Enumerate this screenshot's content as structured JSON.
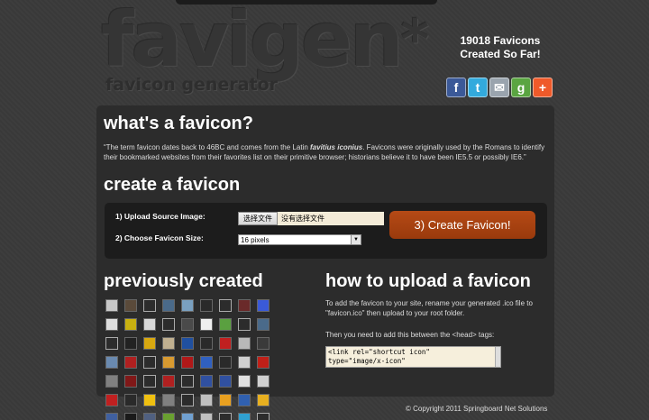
{
  "header": {
    "logo_text": "favigen",
    "logo_star": "*",
    "logo_subtitle": "favicon generator",
    "counter_line1": "19018 Favicons",
    "counter_line2": "Created So Far!",
    "social": [
      {
        "name": "facebook",
        "glyph": "f",
        "color": "#3b5998"
      },
      {
        "name": "twitter",
        "glyph": "t",
        "color": "#33aadd"
      },
      {
        "name": "email",
        "glyph": "✉",
        "color": "#9aa4ae"
      },
      {
        "name": "google",
        "glyph": "g",
        "color": "#5aa541"
      },
      {
        "name": "addthis",
        "glyph": "+",
        "color": "#ef5a2a"
      }
    ]
  },
  "whats": {
    "heading": "what's a favicon?",
    "text_before": "“The term favicon dates back to 46BC and comes from the Latin ",
    "text_bold": "favitius iconius",
    "text_after": ". Favicons were originally used by the Romans to identify their bookmarked websites from their favorites list on their primitive browser; historians believe it to have been IE5.5 or possibly IE6.”"
  },
  "create": {
    "heading": "create a favicon",
    "upload_label": "1) Upload Source Image:",
    "file_button": "选择文件",
    "file_status": "没有选择文件",
    "size_label": "2) Choose Favicon Size:",
    "size_value": "16 pixels",
    "create_button": "3) Create Favicon!"
  },
  "previous": {
    "heading": "previously created",
    "icons": [
      "#c8c8c8",
      "#5a4a3a",
      "w",
      "#4a6a8a",
      "#7aa0c0",
      "#2a2a2a",
      "w",
      "#6a2a2a",
      "#3a5ad8",
      "#dddddd",
      "#c8b010",
      "#d8d8d8",
      "w",
      "#4a4a4a",
      "#f0f0f0",
      "#5aa040",
      "w",
      "#4a6a8a",
      "w",
      "#222222",
      "#d8a810",
      "#c0b090",
      "#2050a0",
      "#2a2a2a",
      "#c02020",
      "#b8b8b8",
      "#3a3a3a",
      "#6a8ab0",
      "#b02020",
      "w",
      "#d89a30",
      "#b01818",
      "#3060c0",
      "#2a2a2a",
      "#d0d0d0",
      "#c02018",
      "#808080",
      "#801818",
      "w",
      "#b02020",
      "w",
      "#3050a0",
      "#3050a0",
      "#e0e0e0",
      "#d0d0d0",
      "#c02020",
      "#2a2a2a",
      "#f0c010",
      "#808080",
      "w",
      "#c0c0c0",
      "#e8a020",
      "#3060b0",
      "#e8b020",
      "#4060a0",
      "#1a1a1a",
      "#506080",
      "#6aa030",
      "#70a0d0",
      "#c0c0c0",
      "w",
      "#30a0d0",
      "w"
    ]
  },
  "howto": {
    "heading": "how to upload a favicon",
    "para1": "To add the favicon to your site, rename your generated .ico file to \"favicon.ico\" then upload to your root folder.",
    "para2": "Then you need to add this between the <head> tags:",
    "code": "<link rel=\"shortcut icon\"\ntype=\"image/x-icon\""
  },
  "footer": {
    "copyright": "© Copyright 2011 Springboard Net Solutions"
  }
}
